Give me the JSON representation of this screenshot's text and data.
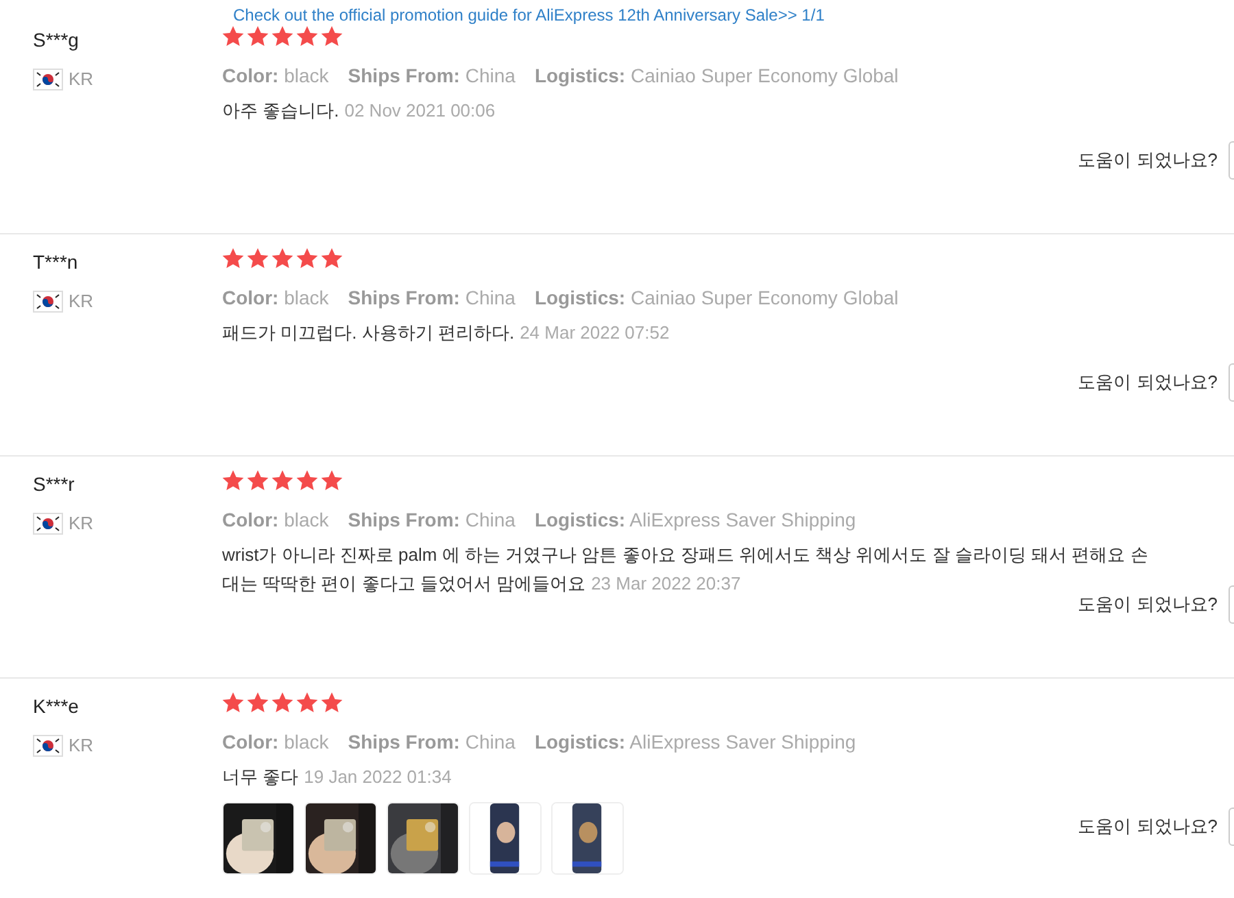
{
  "banner": {
    "text": "Check out the official promotion guide for AliExpress 12th Anniversary Sale>>  1/1"
  },
  "reviews": [
    {
      "name": "S***g",
      "country": "KR",
      "stars": 5,
      "attributes": [
        {
          "label": "Color:",
          "value": "black"
        },
        {
          "label": "Ships From:",
          "value": "China"
        },
        {
          "label": "Logistics:",
          "value": "Cainiao Super Economy Global"
        }
      ],
      "text": "아주 좋습니다.",
      "date": "02 Nov 2021 00:06",
      "helpful": "도움이 되었나요?"
    },
    {
      "name": "T***n",
      "country": "KR",
      "stars": 5,
      "attributes": [
        {
          "label": "Color:",
          "value": "black"
        },
        {
          "label": "Ships From:",
          "value": "China"
        },
        {
          "label": "Logistics:",
          "value": "Cainiao Super Economy Global"
        }
      ],
      "text": "패드가 미끄럽다. 사용하기 편리하다.",
      "date": "24 Mar 2022 07:52",
      "helpful": "도움이 되었나요?"
    },
    {
      "name": "S***r",
      "country": "KR",
      "stars": 5,
      "attributes": [
        {
          "label": "Color:",
          "value": "black"
        },
        {
          "label": "Ships From:",
          "value": "China"
        },
        {
          "label": "Logistics:",
          "value": "AliExpress Saver Shipping"
        }
      ],
      "text": "wrist가 아니라 진짜로 palm 에 하는 거였구나 암튼 좋아요 장패드 위에서도 책상 위에서도 잘 슬라이딩 돼서 편해요 손\n대는 딱딱한 편이 좋다고 들었어서 맘에들어요",
      "date": "23 Mar 2022 20:37",
      "helpful": "도움이 되었나요?"
    },
    {
      "name": "K***e",
      "country": "KR",
      "stars": 5,
      "attributes": [
        {
          "label": "Color:",
          "value": "black"
        },
        {
          "label": "Ships From:",
          "value": "China"
        },
        {
          "label": "Logistics:",
          "value": "AliExpress Saver Shipping"
        }
      ],
      "text": "너무 좋다",
      "date": "19 Jan 2022 01:34",
      "photos": [
        {
          "kind": "picture"
        },
        {
          "kind": "picture"
        },
        {
          "kind": "picture"
        },
        {
          "kind": "picture"
        },
        {
          "kind": "picture"
        }
      ],
      "helpful": "도움이 되었나요?"
    }
  ]
}
